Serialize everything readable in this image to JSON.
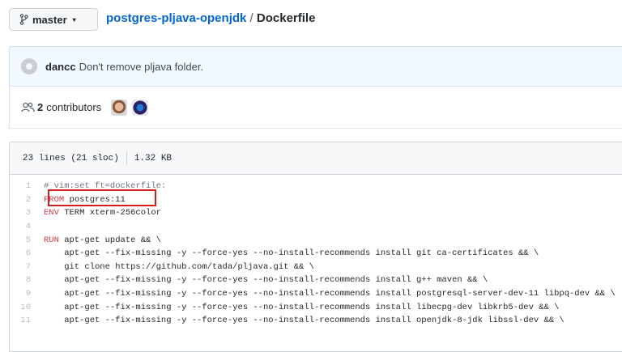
{
  "branch": {
    "label": "master",
    "caret": "▾"
  },
  "breadcrumb": {
    "repo": "postgres-pljava-openjdk",
    "separator": " / ",
    "file": "Dockerfile"
  },
  "commit": {
    "author": "dancc",
    "message": "Don't remove pljava folder."
  },
  "contributors": {
    "count": "2",
    "label": "contributors"
  },
  "file_info": {
    "lines": "23 lines (21 sloc)",
    "size": "1.32 KB"
  },
  "code_lines": [
    {
      "num": "1",
      "kw": "",
      "rest": "# vim:set ft=dockerfile:",
      "comment": true
    },
    {
      "num": "2",
      "kw": "FROM",
      "rest": " postgres:11",
      "comment": false
    },
    {
      "num": "3",
      "kw": "ENV",
      "rest": " TERM xterm-256color",
      "comment": false
    },
    {
      "num": "4",
      "kw": "",
      "rest": "",
      "comment": false
    },
    {
      "num": "5",
      "kw": "RUN",
      "rest": " apt-get update && \\",
      "comment": false
    },
    {
      "num": "6",
      "kw": "",
      "rest": "    apt-get --fix-missing -y --force-yes --no-install-recommends install git ca-certificates && \\",
      "comment": false
    },
    {
      "num": "7",
      "kw": "",
      "rest": "    git clone https://github.com/tada/pljava.git && \\",
      "comment": false
    },
    {
      "num": "8",
      "kw": "",
      "rest": "    apt-get --fix-missing -y --force-yes --no-install-recommends install g++ maven && \\",
      "comment": false
    },
    {
      "num": "9",
      "kw": "",
      "rest": "    apt-get --fix-missing -y --force-yes --no-install-recommends install postgresql-server-dev-11 libpq-dev && \\",
      "comment": false
    },
    {
      "num": "10",
      "kw": "",
      "rest": "    apt-get --fix-missing -y --force-yes --no-install-recommends install libecpg-dev libkrb5-dev && \\",
      "comment": false
    },
    {
      "num": "11",
      "kw": "",
      "rest": "    apt-get --fix-missing -y --force-yes --no-install-recommends install openjdk-8-jdk libssl-dev && \\",
      "comment": false
    }
  ],
  "colors": {
    "link": "#0366d6",
    "keyword": "#d73a49",
    "highlight_border": "#d01f1f",
    "commit_bg": "#f1f8ff"
  }
}
